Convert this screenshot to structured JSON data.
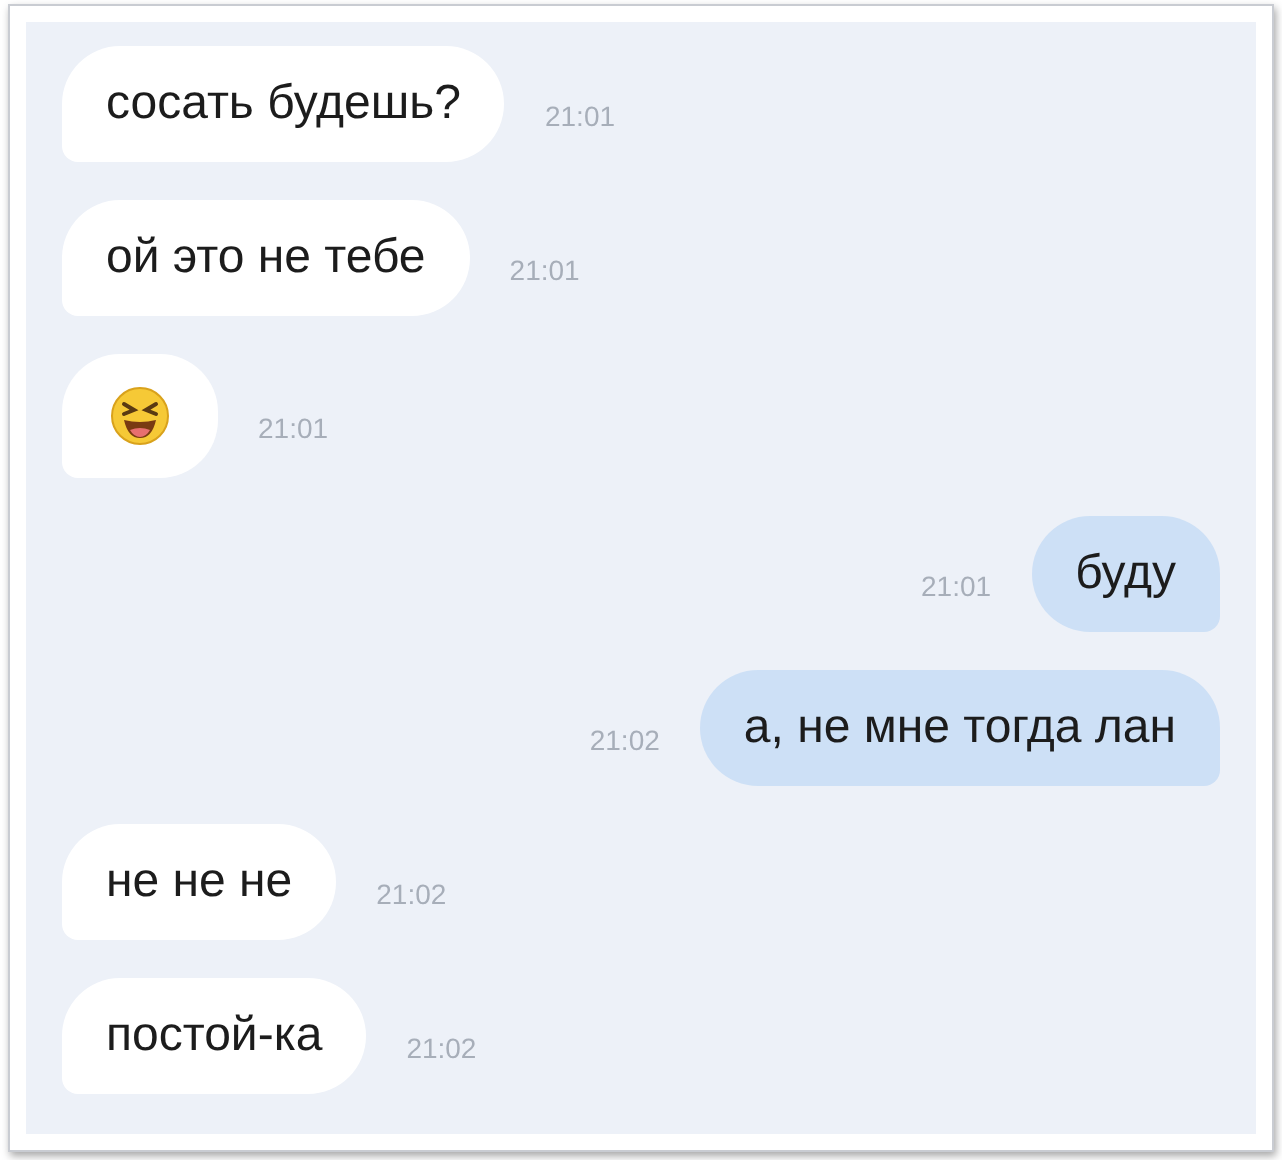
{
  "messages": [
    {
      "outgoing": false,
      "kind": "text",
      "text": "сосать будешь?",
      "time": "21:01"
    },
    {
      "outgoing": false,
      "kind": "text",
      "text": "ой это не тебе",
      "time": "21:01"
    },
    {
      "outgoing": false,
      "kind": "emoji",
      "time": "21:01"
    },
    {
      "outgoing": true,
      "kind": "text",
      "text": "буду",
      "time": "21:01"
    },
    {
      "outgoing": true,
      "kind": "text",
      "text": "а, не мне тогда лан",
      "time": "21:02"
    },
    {
      "outgoing": false,
      "kind": "text",
      "text": "не не не",
      "time": "21:02"
    },
    {
      "outgoing": false,
      "kind": "text",
      "text": "постой-ка",
      "time": "21:02"
    }
  ]
}
